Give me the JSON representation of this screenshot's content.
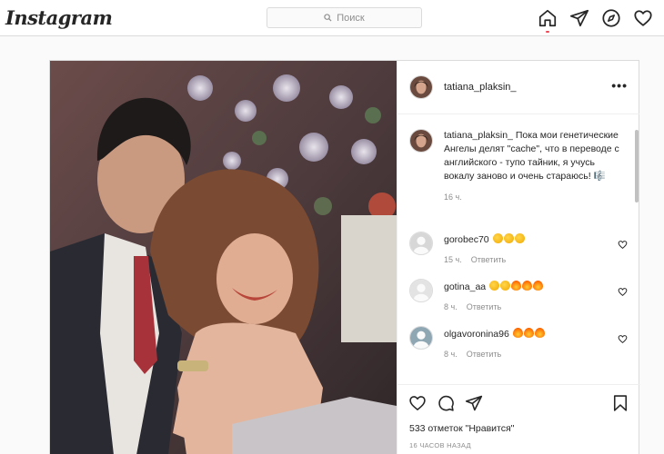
{
  "topbar": {
    "logo": "Instagram",
    "search_placeholder": "Поиск"
  },
  "post": {
    "username": "tatiana_plaksin_",
    "caption": {
      "username": "tatiana_plaksin_",
      "text": "Пока мои генетические Ангелы делят \"cache\", что в переводе с английского - тупо тайник, я учусь вокалу заново и очень стараюсь! 🎼",
      "time": "16 ч."
    },
    "comments": [
      {
        "username": "gorobec70",
        "time": "15 ч.",
        "reply": "Ответить",
        "emoji": [
          "clap",
          "clap",
          "clap"
        ]
      },
      {
        "username": "gotina_aa",
        "time": "8 ч.",
        "reply": "Ответить",
        "emoji": [
          "clap",
          "clap",
          "fire",
          "fire",
          "fire"
        ]
      },
      {
        "username": "olgavoronina96",
        "time": "8 ч.",
        "reply": "Ответить",
        "emoji": [
          "fire",
          "fire",
          "fire"
        ]
      }
    ],
    "likes": "533 отметок \"Нравится\"",
    "posted": "16 ЧАСОВ НАЗАД"
  },
  "colors": {
    "border": "#dbdbdb",
    "muted": "#8e8e8e",
    "accent_dot": "#ed4956"
  },
  "icons": [
    "search-icon",
    "home-icon",
    "direct-icon",
    "explore-icon",
    "activity-heart-icon",
    "more-icon",
    "like-icon",
    "comment-icon",
    "share-icon",
    "save-icon"
  ]
}
